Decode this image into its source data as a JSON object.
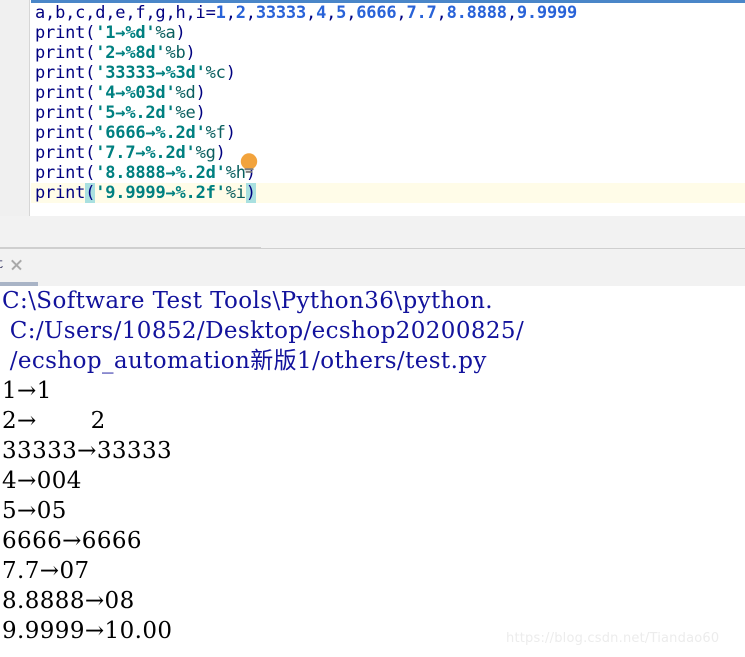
{
  "editor": {
    "current_line_index": 9,
    "bulb_icon": "lightbulb-intention-icon",
    "lines": [
      {
        "segments": [
          {
            "text": "a,b,c,d,e,f,g,h,i=",
            "cls": "tok-plain"
          },
          {
            "text": "1",
            "cls": "tok-num"
          },
          {
            "text": ",",
            "cls": "tok-plain"
          },
          {
            "text": "2",
            "cls": "tok-num"
          },
          {
            "text": ",",
            "cls": "tok-plain"
          },
          {
            "text": "33333",
            "cls": "tok-num"
          },
          {
            "text": ",",
            "cls": "tok-plain"
          },
          {
            "text": "4",
            "cls": "tok-num"
          },
          {
            "text": ",",
            "cls": "tok-plain"
          },
          {
            "text": "5",
            "cls": "tok-num"
          },
          {
            "text": ",",
            "cls": "tok-plain"
          },
          {
            "text": "6666",
            "cls": "tok-num"
          },
          {
            "text": ",",
            "cls": "tok-plain"
          },
          {
            "text": "7.7",
            "cls": "tok-num"
          },
          {
            "text": ",",
            "cls": "tok-plain"
          },
          {
            "text": "8.8888",
            "cls": "tok-num"
          },
          {
            "text": ",",
            "cls": "tok-plain"
          },
          {
            "text": "9.9999",
            "cls": "tok-num"
          }
        ]
      },
      {
        "segments": [
          {
            "text": "print(",
            "cls": "tok-plain"
          },
          {
            "text": "'1→%d'",
            "cls": "tok-str"
          },
          {
            "text": "%a",
            "cls": "tok-fmt"
          },
          {
            "text": ")",
            "cls": "tok-plain"
          }
        ]
      },
      {
        "segments": [
          {
            "text": "print(",
            "cls": "tok-plain"
          },
          {
            "text": "'2→%8d'",
            "cls": "tok-str"
          },
          {
            "text": "%b",
            "cls": "tok-fmt"
          },
          {
            "text": ")",
            "cls": "tok-plain"
          }
        ]
      },
      {
        "segments": [
          {
            "text": "print(",
            "cls": "tok-plain"
          },
          {
            "text": "'33333→%3d'",
            "cls": "tok-str"
          },
          {
            "text": "%c",
            "cls": "tok-fmt"
          },
          {
            "text": ")",
            "cls": "tok-plain"
          }
        ]
      },
      {
        "segments": [
          {
            "text": "print(",
            "cls": "tok-plain"
          },
          {
            "text": "'4→%03d'",
            "cls": "tok-str"
          },
          {
            "text": "%d",
            "cls": "tok-fmt"
          },
          {
            "text": ")",
            "cls": "tok-plain"
          }
        ]
      },
      {
        "segments": [
          {
            "text": "print(",
            "cls": "tok-plain"
          },
          {
            "text": "'5→%.2d'",
            "cls": "tok-str"
          },
          {
            "text": "%e",
            "cls": "tok-fmt"
          },
          {
            "text": ")",
            "cls": "tok-plain"
          }
        ]
      },
      {
        "segments": [
          {
            "text": "print(",
            "cls": "tok-plain"
          },
          {
            "text": "'6666→%.2d'",
            "cls": "tok-str"
          },
          {
            "text": "%f",
            "cls": "tok-fmt"
          },
          {
            "text": ")",
            "cls": "tok-plain"
          }
        ]
      },
      {
        "segments": [
          {
            "text": "print(",
            "cls": "tok-plain"
          },
          {
            "text": "'7.7→%.2d'",
            "cls": "tok-str"
          },
          {
            "text": "%g",
            "cls": "tok-fmt"
          },
          {
            "text": ")",
            "cls": "tok-plain"
          }
        ]
      },
      {
        "segments": [
          {
            "text": "print(",
            "cls": "tok-plain"
          },
          {
            "text": "'8.8888→%.2d'",
            "cls": "tok-str"
          },
          {
            "text": "%h",
            "cls": "tok-fmt"
          },
          {
            "text": ")",
            "cls": "tok-plain"
          }
        ]
      },
      {
        "segments": [
          {
            "text": "print",
            "cls": "tok-plain"
          },
          {
            "text": "(",
            "cls": "tok-paren-hl"
          },
          {
            "text": "'9.9999→%.2f'",
            "cls": "tok-str"
          },
          {
            "text": "%i",
            "cls": "tok-fmt"
          },
          {
            "text": ")",
            "cls": "tok-paren-hl"
          }
        ]
      }
    ]
  },
  "run_panel": {
    "tab_label": "st",
    "close_icon": "close-icon"
  },
  "console": {
    "lines": [
      {
        "text": "C:\\Software Test Tools\\Python36\\python.",
        "kind": "path"
      },
      {
        "text": " C:/Users/10852/Desktop/ecshop20200825/",
        "kind": "path"
      },
      {
        "text": " /ecshop_automation新版1/others/test.py",
        "kind": "path"
      },
      {
        "text": "1→1",
        "kind": "out"
      },
      {
        "text": "2→       2",
        "kind": "out"
      },
      {
        "text": "33333→33333",
        "kind": "out"
      },
      {
        "text": "4→004",
        "kind": "out"
      },
      {
        "text": "5→05",
        "kind": "out"
      },
      {
        "text": "6666→6666",
        "kind": "out"
      },
      {
        "text": "7.7→07",
        "kind": "out"
      },
      {
        "text": "8.8888→08",
        "kind": "out"
      },
      {
        "text": "9.9999→10.00",
        "kind": "out"
      }
    ]
  },
  "watermark": {
    "text": "https://blog.csdn.net/Tiandao60"
  },
  "colors": {
    "gutter": "#f0f0f0",
    "editor_bg": "#ffffff",
    "top_accent": "#4a86c8",
    "current_line": "#fffce8",
    "string": "#008080",
    "number": "#2963d8",
    "keyword_plain": "#000080",
    "paren_match": "#a9e0e0",
    "console_path": "#12129c",
    "console_out": "#000000",
    "panel_bg": "#f2f2f2",
    "tab_underline": "#a9b4c6",
    "bulb": "#f2a33c"
  }
}
